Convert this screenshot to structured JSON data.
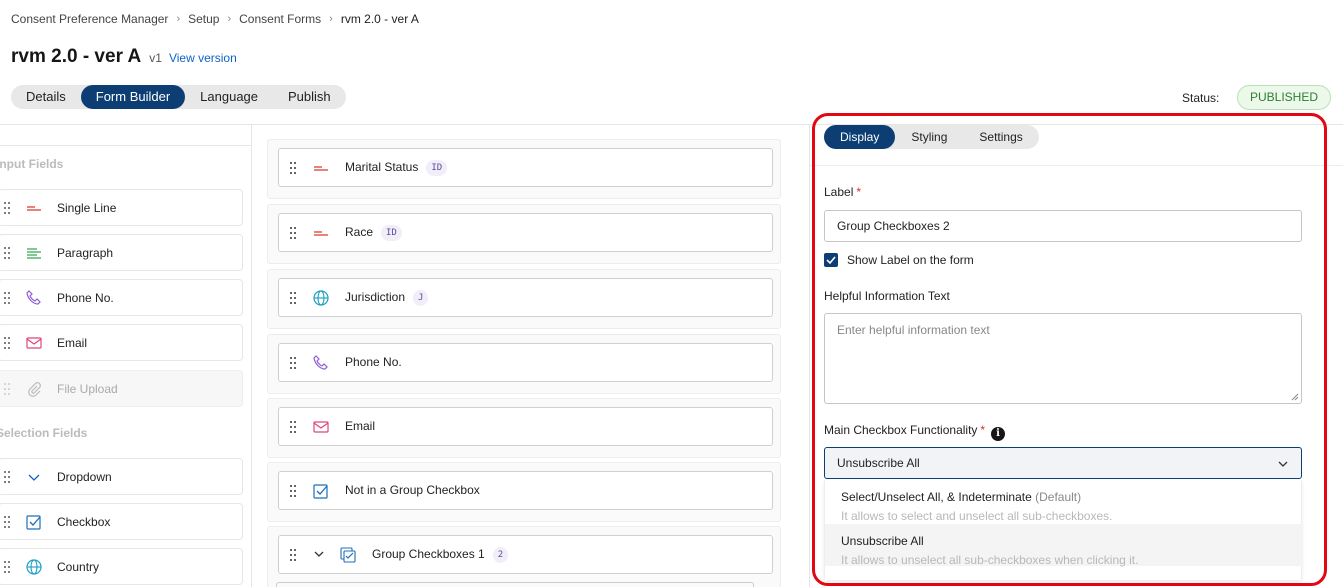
{
  "breadcrumb": [
    "Consent Preference Manager",
    "Setup",
    "Consent Forms",
    "rvm 2.0 - ver A"
  ],
  "header": {
    "title": "rvm 2.0 - ver A",
    "version": "v1",
    "view_version_label": "View version",
    "status_label": "Status:",
    "status_value": "PUBLISHED",
    "status_color": "#2e7d32"
  },
  "main_tabs": [
    "Details",
    "Form Builder",
    "Language",
    "Publish"
  ],
  "active_main_tab": "Form Builder",
  "palette": {
    "input_heading": "Input Fields",
    "input_items": [
      {
        "label": "Single Line",
        "icon": "single-line-icon"
      },
      {
        "label": "Paragraph",
        "icon": "paragraph-icon"
      },
      {
        "label": "Phone No.",
        "icon": "phone-icon"
      },
      {
        "label": "Email",
        "icon": "email-icon"
      },
      {
        "label": "File Upload",
        "icon": "paperclip-icon",
        "disabled": true
      }
    ],
    "selection_heading": "Selection Fields",
    "selection_items": [
      {
        "label": "Dropdown",
        "icon": "chevron-down-icon"
      },
      {
        "label": "Checkbox",
        "icon": "checkbox-icon"
      },
      {
        "label": "Country",
        "icon": "globe-icon"
      }
    ]
  },
  "canvas_fields": [
    {
      "label": "Marital Status",
      "tag": "ID",
      "icon": "single-line-icon"
    },
    {
      "label": "Race",
      "tag": "ID",
      "icon": "single-line-icon"
    },
    {
      "label": "Jurisdiction",
      "tag": "J",
      "icon": "globe-icon"
    },
    {
      "label": "Phone No.",
      "tag": "",
      "icon": "phone-icon"
    },
    {
      "label": "Email",
      "tag": "",
      "icon": "email-icon"
    },
    {
      "label": "Not in a Group Checkbox",
      "tag": "",
      "icon": "checkbox-icon"
    },
    {
      "label": "Group Checkboxes 1",
      "tag": "2",
      "icon": "group-checkbox-icon"
    }
  ],
  "properties": {
    "tabs": [
      "Display",
      "Styling",
      "Settings"
    ],
    "active_tab": "Display",
    "label_title": "Label",
    "required_mark": "*",
    "label_value": "Group Checkboxes 2",
    "show_label_text": "Show Label on the form",
    "show_label_checked": true,
    "helpful_title": "Helpful Information Text",
    "helpful_placeholder": "Enter helpful information text",
    "functionality_title": "Main Checkbox Functionality",
    "info_glyph": "i",
    "functionality_value": "Unsubscribe All",
    "options": [
      {
        "title": "Select/Unselect All, & Indeterminate",
        "suffix": "(Default)",
        "description": "It allows to select and unselect all sub-checkboxes."
      },
      {
        "title": "Unsubscribe All",
        "suffix": "",
        "description": "It allows to unselect all sub-checkboxes when clicking it."
      }
    ]
  },
  "colors": {
    "accent": "#0c3e73",
    "link": "#0f62c9",
    "highlight_border": "#e30613"
  }
}
